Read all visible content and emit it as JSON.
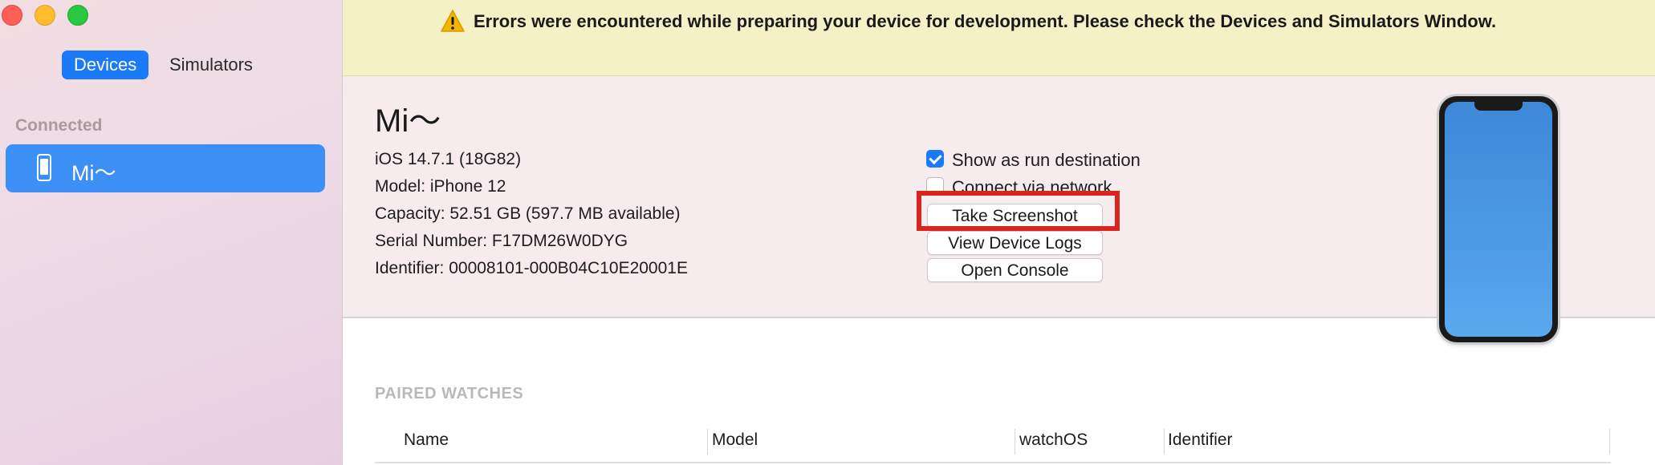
{
  "window": {
    "traffic_lights": {
      "close_color": "#ff5f57",
      "minimize_color": "#febc2e",
      "zoom_color": "#28c840"
    }
  },
  "sidebar": {
    "segments": [
      "Devices",
      "Simulators"
    ],
    "selected_segment": "Devices",
    "section_header": "Connected",
    "devices": [
      {
        "name": "Mi～",
        "icon": "iphone-icon",
        "selected": true
      }
    ]
  },
  "banner": {
    "icon": "warning-icon",
    "text": "Errors were encountered while preparing your device for development. Please check the Devices and Simulators Window."
  },
  "device": {
    "name": "Mi～",
    "info": [
      "iOS 14.7.1 (18G82)",
      "Model: iPhone 12",
      "Capacity: 52.51 GB (597.7 MB available)",
      "Serial Number: F17DM26W0DYG",
      "Identifier: 00008101-000B04C10E20001E"
    ],
    "options": {
      "show_as_run_destination": {
        "label": "Show as run destination",
        "checked": true
      },
      "connect_via_network": {
        "label": "Connect via network",
        "checked": false
      }
    },
    "buttons": {
      "take_screenshot": "Take Screenshot",
      "view_device_logs": "View Device Logs",
      "open_console": "Open Console"
    }
  },
  "paired_watches": {
    "title": "PAIRED WATCHES",
    "columns": [
      "Name",
      "Model",
      "watchOS",
      "Identifier"
    ],
    "rows": []
  },
  "colors": {
    "accent": "#1a7af8",
    "banner_bg": "#f4f1c6",
    "highlight": "#d9251d"
  }
}
